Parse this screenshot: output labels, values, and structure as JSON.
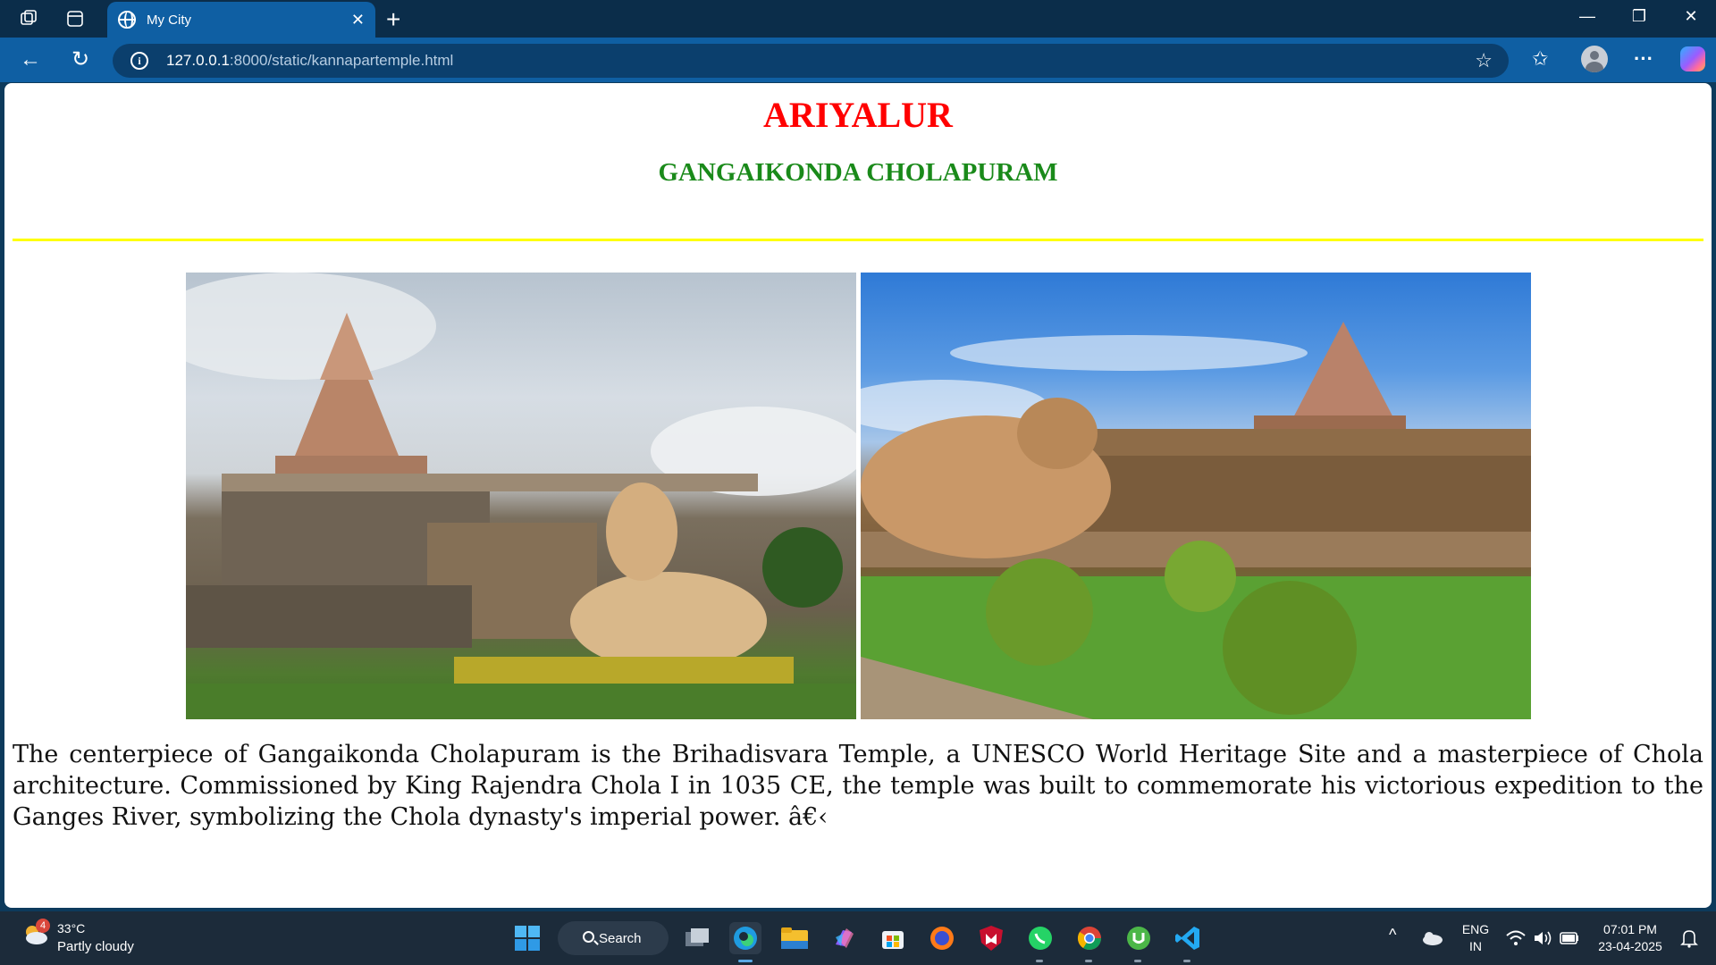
{
  "browser": {
    "tab_title": "My City",
    "url_host": "127.0.0.1",
    "url_rest": ":8000/static/kannapartemple.html"
  },
  "page": {
    "heading": "ARIYALUR",
    "subheading": "GANGAIKONDA CHOLAPURAM",
    "paragraph": "The centerpiece of Gangaikonda Cholapuram is the Brihadisvara Temple, a UNESCO World Heritage Site and a masterpiece of Chola architecture. Commissioned by King Rajendra Chola I in 1035 CE, the temple was built to commemorate his victorious expedition to the Ganges River, symbolizing the Chola dynasty's imperial power. â€‹",
    "colors": {
      "heading": "#ff0000",
      "subheading": "#1a8a1a",
      "rule": "#ffff00"
    }
  },
  "taskbar": {
    "weather_temp": "33°C",
    "weather_desc": "Partly cloudy",
    "weather_badge": "4",
    "search_label": "Search",
    "lang_top": "ENG",
    "lang_bottom": "IN",
    "time": "07:01 PM",
    "date": "23-04-2025"
  }
}
